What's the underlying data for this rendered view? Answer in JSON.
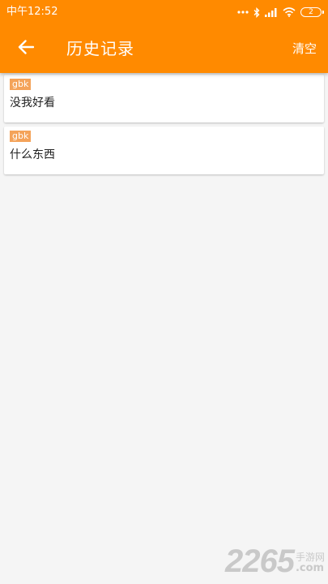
{
  "status_bar": {
    "time": "中午12:52",
    "battery_level": "2"
  },
  "toolbar": {
    "back_icon": "arrow-left-icon",
    "title": "历史记录",
    "clear_label": "清空"
  },
  "history": {
    "items": [
      {
        "encoding": "gbk",
        "text": "没我好看"
      },
      {
        "encoding": "gbk",
        "text": "什么东西"
      }
    ]
  },
  "watermark": {
    "number": "2265",
    "site": "手游网",
    "tld": ".com"
  },
  "colors": {
    "accent": "#ff8a00",
    "badge": "#f4a35a",
    "background": "#f5f5f5"
  }
}
